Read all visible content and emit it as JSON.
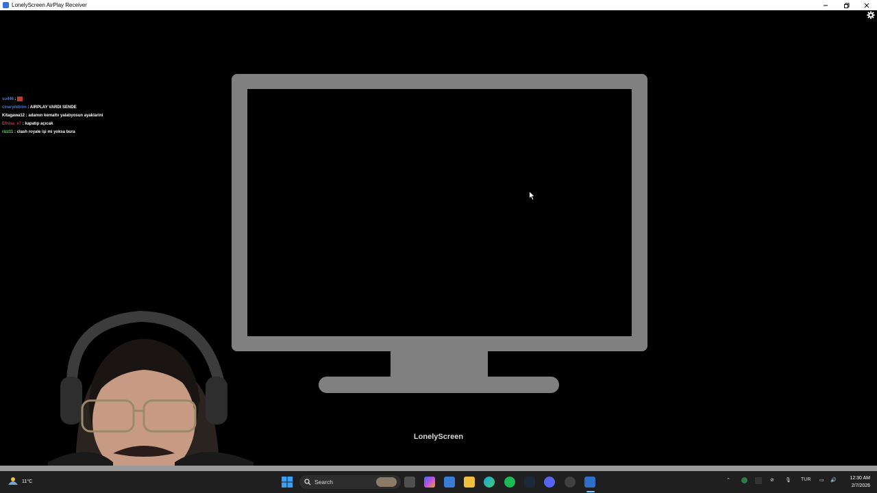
{
  "window": {
    "title": "LonelyScreen AirPlay Receiver",
    "controls": [
      "minimize",
      "maximize",
      "close"
    ]
  },
  "chat": [
    {
      "user": "su446",
      "message": "",
      "user_color": "#4b7bd6"
    },
    {
      "user": "cinaryildirim",
      "message": "AIRPLAY VARDI SENDE",
      "user_color": "#4b7bd6"
    },
    {
      "user": "Kitagawa12",
      "message": "adamın kemaltv yalatıyosun ayaklarini",
      "user_color": "#ffffff"
    },
    {
      "user": "Efnisa_x7",
      "message": "kapatıp açıcak",
      "user_color": "#d03050"
    },
    {
      "user": "rizz11",
      "message": "clash royale işi mi yoksa bura",
      "user_color": "#5ce65c"
    }
  ],
  "main": {
    "brand": "LonelyScreen"
  },
  "taskbar": {
    "weather": {
      "temp": "11°C"
    },
    "search_label": "Search",
    "language": "TUR",
    "time": "12:30 AM",
    "date": "2/7/2026",
    "colors": {
      "accent": "#60cdff"
    }
  }
}
